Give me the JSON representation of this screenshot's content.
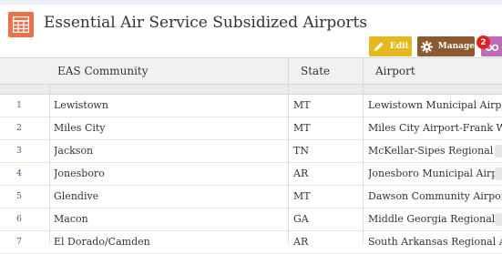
{
  "app": {
    "title": "Essential Air Service Subsidized Airports"
  },
  "toolbar": {
    "edit_label": "Edit",
    "manage_label": "Manage",
    "badge_count": "2"
  },
  "columns": [
    "EAS Community",
    "State",
    "Airport"
  ],
  "rows": [
    {
      "num": "1",
      "community": "Lewistown",
      "state": "MT",
      "airport": "Lewistown Municipal Airport"
    },
    {
      "num": "2",
      "community": "Miles City",
      "state": "MT",
      "airport": "Miles City Airport-Frank Wiley Field"
    },
    {
      "num": "3",
      "community": "Jackson",
      "state": "TN",
      "airport": "McKellar-Sipes Regional Airport"
    },
    {
      "num": "4",
      "community": "Jonesboro",
      "state": "AR",
      "airport": "Jonesboro Municipal Airport"
    },
    {
      "num": "5",
      "community": "Glendive",
      "state": "MT",
      "airport": "Dawson Community Airport"
    },
    {
      "num": "6",
      "community": "Macon",
      "state": "GA",
      "airport": "Middle Georgia Regional Airport"
    },
    {
      "num": "7",
      "community": "El Dorado/Camden",
      "state": "AR",
      "airport": "South Arkansas Regional Airport"
    }
  ],
  "colors": {
    "edit": "#e4b81e",
    "manage": "#8b5a2f",
    "view": "#c06bb9",
    "badge": "#e0211d",
    "app_icon": "#e8724b"
  },
  "icons": {
    "app": "table-icon",
    "edit": "pencil-icon",
    "manage": "gear-icon",
    "view": "binoculars-icon"
  }
}
